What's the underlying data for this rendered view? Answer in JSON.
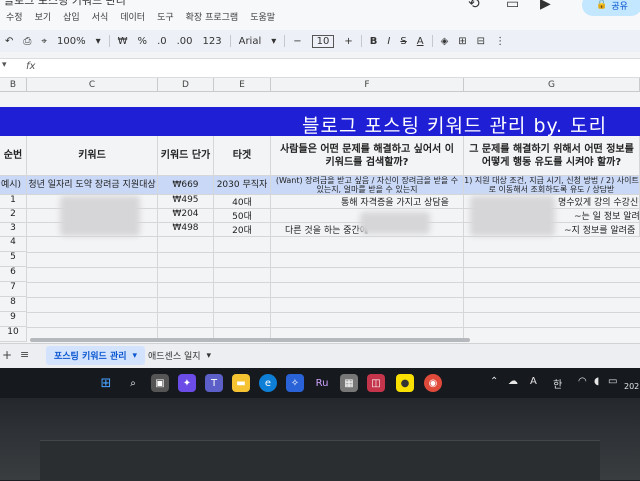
{
  "window": {
    "doc_title": "블로그 포스팅 키워드 관리",
    "share_label": "공유"
  },
  "menu": [
    "수정",
    "보기",
    "삽입",
    "서식",
    "데이터",
    "도구",
    "확장 프로그램",
    "도움말"
  ],
  "toolbar": {
    "zoom": "100%",
    "currency": "₩",
    "percent": "%",
    "dec_dec": ".0",
    "dec_inc": ".00",
    "num_format": "123",
    "font": "Arial",
    "font_size": "10",
    "minus": "−",
    "plus": "+",
    "bold": "B",
    "italic": "I",
    "strike": "S",
    "textcolor": "A"
  },
  "formula_bar": {
    "fx": "fx"
  },
  "columns": [
    "B",
    "C",
    "D",
    "E",
    "F",
    "G"
  ],
  "title_banner": "블로그 포스팅 키워드 관리 by. 도리",
  "headers": {
    "b": "순번",
    "c": "키워드",
    "d": "키워드 단가",
    "e": "타겟",
    "f": "사람들은 어떤 문제를 해결하고 싶어서 이 키워드를 검색할까?",
    "g": "그 문제를 해결하기 위해서 어떤 정보를 어떻게 행동 유도를 시켜야 할까?"
  },
  "rows": [
    {
      "num": "예시)",
      "keyword": "청년 일자리 도약 장려금 지원대상",
      "price": "₩669",
      "target": "2030 무직자",
      "problem": "(Want) 장려금을 받고 싶음 / 자신이 장려금을 받을 수 있는지, 얼마를 받을 수 있는지",
      "solution": "1) 지원 대상 조건, 지급 시기, 신청 방법 / 2) 사이트로 이동해서 조회하도록 유도 / 상담받"
    },
    {
      "num": "1",
      "keyword": "",
      "price": "₩495",
      "target": "40대",
      "problem": "통해 자격증을 가지고 상담을",
      "solution": "명수있게 강의 수강신청유"
    },
    {
      "num": "2",
      "keyword": "",
      "price": "₩204",
      "target": "50대",
      "problem": "",
      "solution": "~는 일 정보 알려줌"
    },
    {
      "num": "3",
      "keyword": "",
      "price": "₩498",
      "target": "20대",
      "problem": "다른 것을 하는 중간에",
      "solution": "~지 정보를 알려줌"
    },
    {
      "num": "4"
    },
    {
      "num": "5"
    },
    {
      "num": "6"
    },
    {
      "num": "7"
    },
    {
      "num": "8"
    },
    {
      "num": "9"
    },
    {
      "num": "10"
    }
  ],
  "sheet_tabs": [
    {
      "label": "포스팅 키워드 관리",
      "active": true
    },
    {
      "label": "애드센스 일지",
      "active": false
    }
  ],
  "taskbar": {
    "tray_lang": "A",
    "tray_ime": "한",
    "tray_date": "202"
  },
  "colors": {
    "banner": "#1f1fd6",
    "example_row": "#c9d8f6",
    "active_tab": "#d3e3fd"
  }
}
